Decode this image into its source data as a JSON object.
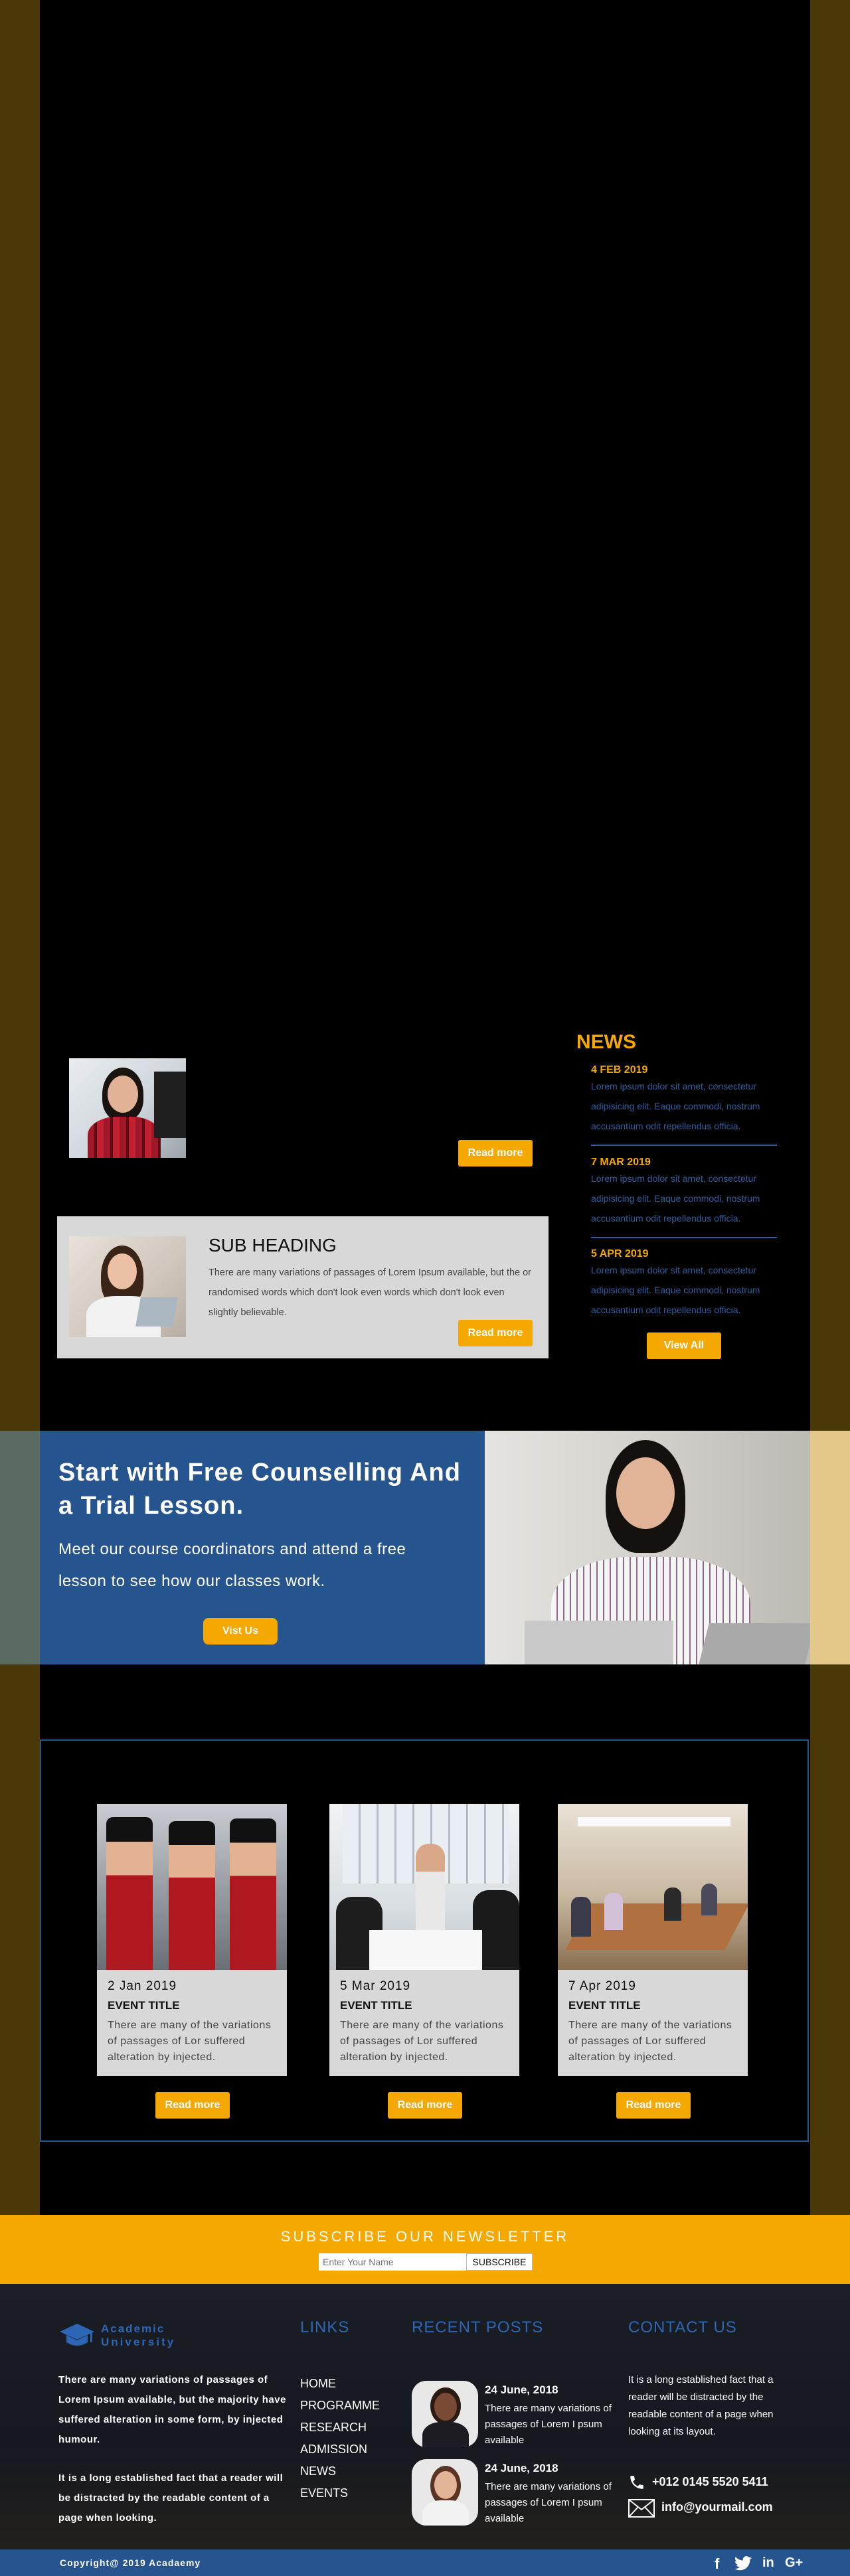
{
  "colors": {
    "accent": "#f5a800",
    "brand_blue": "#26548f",
    "link_blue": "#2d5fa0"
  },
  "post_card": {
    "read_more": "Read more"
  },
  "sub_card": {
    "heading": "SUB HEADING",
    "text": "There are many variations of passages of Lorem Ipsum available, but the  or randomised words which don't look even  words which don't look even slightly believable.",
    "read_more": "Read more"
  },
  "news": {
    "title": "NEWS",
    "items": [
      {
        "date": "4 FEB 2019",
        "text": "Lorem ipsum dolor sit amet, consectetur adipisicing elit. Eaque commodi, nostrum accusantium odit repellendus officia."
      },
      {
        "date": "7 MAR 2019",
        "text": "Lorem ipsum dolor sit amet, consectetur adipisicing elit. Eaque commodi, nostrum accusantium odit repellendus officia."
      },
      {
        "date": "5 APR 2019",
        "text": "Lorem ipsum dolor sit amet, consectetur adipisicing elit. Eaque commodi, nostrum accusantium odit repellendus officia."
      }
    ],
    "view_all": "View All"
  },
  "counselling": {
    "heading": "Start with Free Counselling And a Trial Lesson.",
    "text": "Meet our course coordinators and attend a free lesson to see how our classes work.",
    "button": "Vist Us"
  },
  "events": [
    {
      "date": "2 Jan 2019",
      "title": "EVENT TITLE",
      "text": "There are many of the variations of passages of Lor suffered alteration by injected.",
      "read_more": "Read more"
    },
    {
      "date": "5 Mar 2019",
      "title": "EVENT TITLE",
      "text": "There are many of the variations of passages of Lor suffered alteration by injected.",
      "read_more": "Read more"
    },
    {
      "date": "7 Apr 2019",
      "title": "EVENT TITLE",
      "text": "There are many of the variations of passages of Lor suffered alteration by injected.",
      "read_more": "Read more"
    }
  ],
  "newsletter": {
    "title": "SUBSCRIBE OUR NEWSLETTER",
    "placeholder": "Enter Your Name",
    "button": "SUBSCRIBE"
  },
  "footer": {
    "logo_line1": "Academic",
    "logo_line2": "University",
    "about1": "There are many variations of passages of Lorem Ipsum available, but the majority have suffered alteration in some form, by injected humour.",
    "about2": "It is a long established fact that a reader will be distracted by the readable content of a page when looking.",
    "links_title": "LINKS",
    "links": [
      "HOME",
      "PROGRAMME",
      "RESEARCH",
      "ADMISSION",
      "NEWS",
      "EVENTS"
    ],
    "recent_title": "RECENT POSTS",
    "posts": [
      {
        "date": "24 June, 2018",
        "text": "There are many variations of passages of Lorem I psum available"
      },
      {
        "date": "24 June, 2018",
        "text": "There are many variations of passages of Lorem I psum available"
      }
    ],
    "contact_title": "CONTACT US",
    "contact_text": "It is a long established fact that a reader will be distracted by the readable content of a page when looking at its layout.",
    "phone": "+012 0145 5520 5411",
    "email": "info@yourmail.com",
    "copyright": "Copyright@ 2019 Acadaemy"
  }
}
